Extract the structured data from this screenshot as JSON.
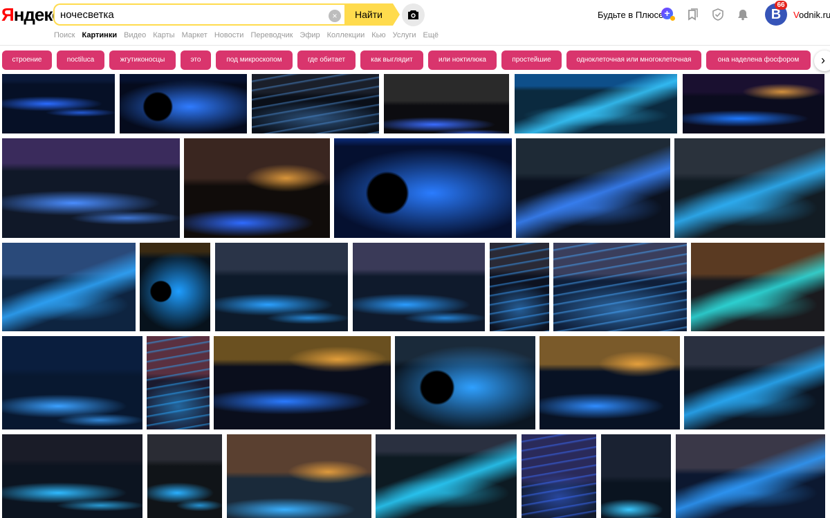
{
  "logo": {
    "first": "Я",
    "rest": "ндекс"
  },
  "search": {
    "query": "ночесветка",
    "clear_glyph": "×",
    "find_label": "Найти",
    "camera_icon": "camera-icon"
  },
  "header": {
    "plus_label": "Будьте в Плюсе",
    "plus_glyph": "+",
    "avatar_letter": "B",
    "avatar_badge": "66",
    "username_v": "V",
    "username_rest": "odnik.ru",
    "icons": [
      "collections-icon",
      "shield-icon",
      "bell-icon"
    ]
  },
  "nav": [
    {
      "label": "Поиск",
      "active": false
    },
    {
      "label": "Картинки",
      "active": true
    },
    {
      "label": "Видео",
      "active": false
    },
    {
      "label": "Карты",
      "active": false
    },
    {
      "label": "Маркет",
      "active": false
    },
    {
      "label": "Новости",
      "active": false
    },
    {
      "label": "Переводчик",
      "active": false
    },
    {
      "label": "Эфир",
      "active": false
    },
    {
      "label": "Коллекции",
      "active": false
    },
    {
      "label": "Кью",
      "active": false
    },
    {
      "label": "Услуги",
      "active": false
    },
    {
      "label": "Ещё",
      "active": false
    }
  ],
  "tags": [
    "строение",
    "noctiluca",
    "жгутиконосцы",
    "это",
    "под микроскопом",
    "где обитает",
    "как выглядит",
    "или ноктилюка",
    "простейшие",
    "одноклеточная или многоклеточная",
    "она наделена фосфором"
  ],
  "tags_next_glyph": "›",
  "colors": {
    "accent_yellow": "#ffdb4d",
    "tag_pink": "#d9356d",
    "logo_red": "#ff0000"
  },
  "images": [
    {
      "sky": "#0b1a3a",
      "glow": "#2a6bff",
      "ground": "#061026",
      "horizon": 0.1,
      "kind": "beach"
    },
    {
      "sky": "#061230",
      "glow": "#2f7bff",
      "ground": "#050b1d",
      "horizon": 0.1,
      "kind": "rocks"
    },
    {
      "sky": "#1a1f2a",
      "glow": "#4a8ad0",
      "ground": "#0a0f18",
      "horizon": 0.3,
      "kind": "waves"
    },
    {
      "sky": "#2a2a2a",
      "glow": "#3a6cff",
      "ground": "#0c0c10",
      "horizon": 0.45,
      "kind": "beach"
    },
    {
      "sky": "#0e4f8a",
      "glow": "#37c8ff",
      "ground": "#0b2a3f",
      "horizon": 0.2,
      "kind": "shore"
    },
    {
      "sky": "#1a1030",
      "glow": "#1e78ff",
      "ground": "#0b0c1e",
      "horizon": 0.3,
      "kind": "sunset"
    },
    {
      "sky": "#3a2b5c",
      "glow": "#4a8dff",
      "ground": "#101828",
      "horizon": 0.25,
      "kind": "beach"
    },
    {
      "sky": "#3a2620",
      "glow": "#2f6bff",
      "ground": "#100c0a",
      "horizon": 0.4,
      "kind": "sunset"
    },
    {
      "sky": "#0a2a7a",
      "glow": "#2a7cff",
      "ground": "#051030",
      "horizon": 0.0,
      "kind": "rocks"
    },
    {
      "sky": "#1e2a36",
      "glow": "#3a86ff",
      "ground": "#0b1220",
      "horizon": 0.35,
      "kind": "shore"
    },
    {
      "sky": "#2a323c",
      "glow": "#2fb6ff",
      "ground": "#121c24",
      "horizon": 0.35,
      "kind": "shore"
    },
    {
      "sky": "#2a4a7a",
      "glow": "#2fa8ff",
      "ground": "#0e2440",
      "horizon": 0.35,
      "kind": "shore"
    },
    {
      "sky": "#3a2a12",
      "glow": "#1e9dff",
      "ground": "#07121c",
      "horizon": 0.1,
      "kind": "rocks"
    },
    {
      "sky": "#2a3448",
      "glow": "#2aa0ff",
      "ground": "#0d1a2a",
      "horizon": 0.3,
      "kind": "beach"
    },
    {
      "sky": "#3a3a58",
      "glow": "#2a9cff",
      "ground": "#0f1a2c",
      "horizon": 0.3,
      "kind": "beach"
    },
    {
      "sky": "#2a2a36",
      "glow": "#3aa0ff",
      "ground": "#0d1220",
      "horizon": 0.3,
      "kind": "waves"
    },
    {
      "sky": "#3a3e5c",
      "glow": "#47a8ff",
      "ground": "#0f1f3a",
      "horizon": 0.35,
      "kind": "waves"
    },
    {
      "sky": "#5a3a22",
      "glow": "#2ee0e0",
      "ground": "#1a1a1e",
      "horizon": 0.35,
      "kind": "shore"
    },
    {
      "sky": "#0a1e3e",
      "glow": "#3aa0ff",
      "ground": "#081830",
      "horizon": 0.35,
      "kind": "beach"
    },
    {
      "sky": "#5a3040",
      "glow": "#2aa8ff",
      "ground": "#1a1a2e",
      "horizon": 0.4,
      "kind": "waves"
    },
    {
      "sky": "#6a5020",
      "glow": "#2a7aff",
      "ground": "#0a0e1c",
      "horizon": 0.25,
      "kind": "sunset"
    },
    {
      "sky": "#1a2a3a",
      "glow": "#2fa0ff",
      "ground": "#0b1622",
      "horizon": 0.25,
      "kind": "rocks"
    },
    {
      "sky": "#7a5a2a",
      "glow": "#2f8cff",
      "ground": "#081224",
      "horizon": 0.3,
      "kind": "sunset"
    },
    {
      "sky": "#2a3040",
      "glow": "#2ab0ff",
      "ground": "#0c1522",
      "horizon": 0.3,
      "kind": "shore"
    },
    {
      "sky": "#1a1c28",
      "glow": "#2fbaff",
      "ground": "#0c1420",
      "horizon": 0.3,
      "kind": "beach"
    },
    {
      "sky": "#2a2c34",
      "glow": "#2ab0ff",
      "ground": "#101418",
      "horizon": 0.3,
      "kind": "beach"
    },
    {
      "sky": "#5a4030",
      "glow": "#3ab0ff",
      "ground": "#1a2a3a",
      "horizon": 0.45,
      "kind": "sunset"
    },
    {
      "sky": "#2a3040",
      "glow": "#2ad0ff",
      "ground": "#0d1a22",
      "horizon": 0.2,
      "kind": "shore"
    },
    {
      "sky": "#2a2a5a",
      "glow": "#3a6cff",
      "ground": "#121a2a",
      "horizon": 0.55,
      "kind": "waves"
    },
    {
      "sky": "#1a2232",
      "glow": "#3ac8ff",
      "ground": "#0a1420",
      "horizon": 0.5,
      "kind": "beach"
    },
    {
      "sky": "#3a3848",
      "glow": "#2f9cff",
      "ground": "#0c1830",
      "horizon": 0.4,
      "kind": "shore"
    }
  ]
}
